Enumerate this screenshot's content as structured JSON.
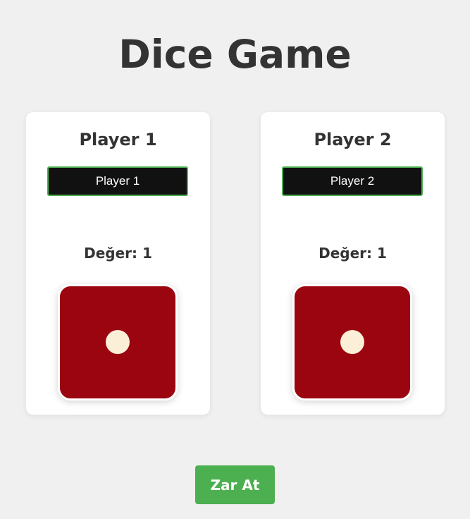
{
  "title": "Dice Game",
  "players": [
    {
      "heading": "Player 1",
      "name_value": "Player 1",
      "value_text": "Değer: 1",
      "die_value": 1
    },
    {
      "heading": "Player 2",
      "name_value": "Player 2",
      "value_text": "Değer: 1",
      "die_value": 1
    }
  ],
  "roll_button_label": "Zar At",
  "colors": {
    "background": "#f0f0f0",
    "card": "#ffffff",
    "accent": "#4caf50",
    "die": "#9b050f",
    "pip": "#fbefd8",
    "input_bg": "#111111",
    "text": "#333333"
  },
  "icons": {
    "die": "die-face-1-icon",
    "pip": "pip-icon"
  }
}
